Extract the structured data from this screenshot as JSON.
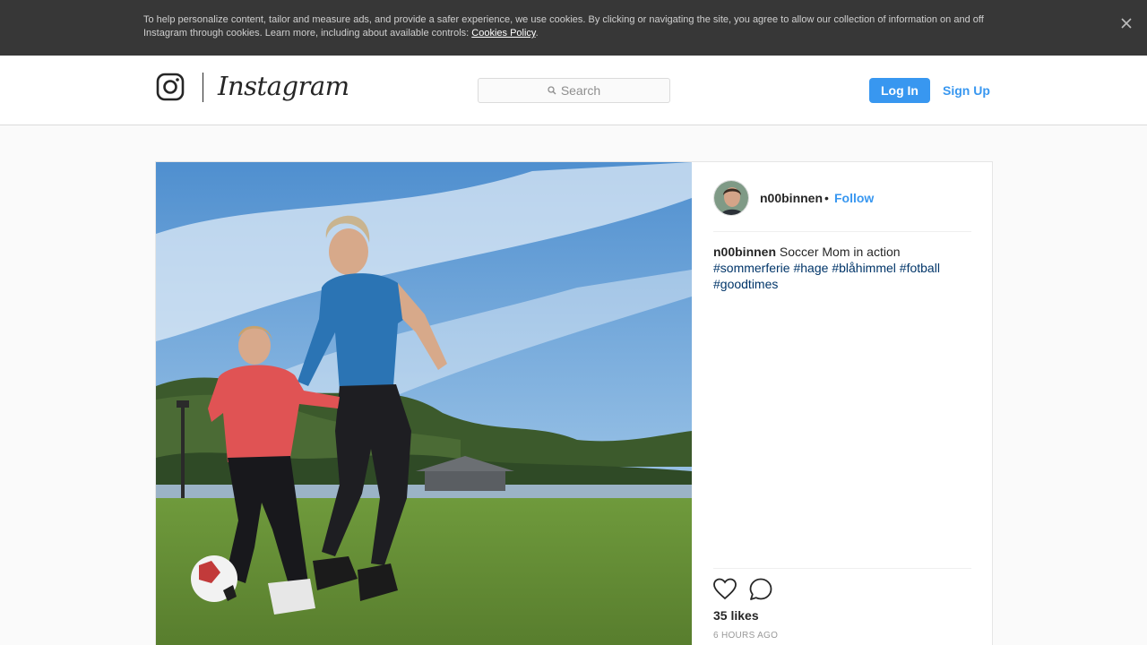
{
  "cookie_banner": {
    "text": "To help personalize content, tailor and measure ads, and provide a safer experience, we use cookies. By clicking or navigating the site, you agree to allow our collection of information on and off Instagram through cookies. Learn more, including about available controls: ",
    "link_label": "Cookies Policy",
    "trailing": "."
  },
  "nav": {
    "logo_word": "Instagram",
    "search_placeholder": "Search",
    "login_label": "Log In",
    "signup_label": "Sign Up"
  },
  "post": {
    "username": "n00binnen",
    "separator": "•",
    "follow_label": "Follow",
    "caption_user": "n00binnen",
    "caption_text": "Soccer Mom in action",
    "hashtags": [
      "#sommerferie",
      "#hage",
      "#blåhimmel",
      "#fotball",
      "#goodtimes"
    ],
    "likes": "35 likes",
    "time": "6 HOURS AGO"
  },
  "icons": {
    "close": "close-icon",
    "logo": "instagram-camera-icon",
    "search": "search-icon",
    "like": "heart-icon",
    "comment": "comment-bubble-icon"
  },
  "colors": {
    "accent": "#3897f0",
    "hashtag": "#003569",
    "banner": "#373737"
  }
}
